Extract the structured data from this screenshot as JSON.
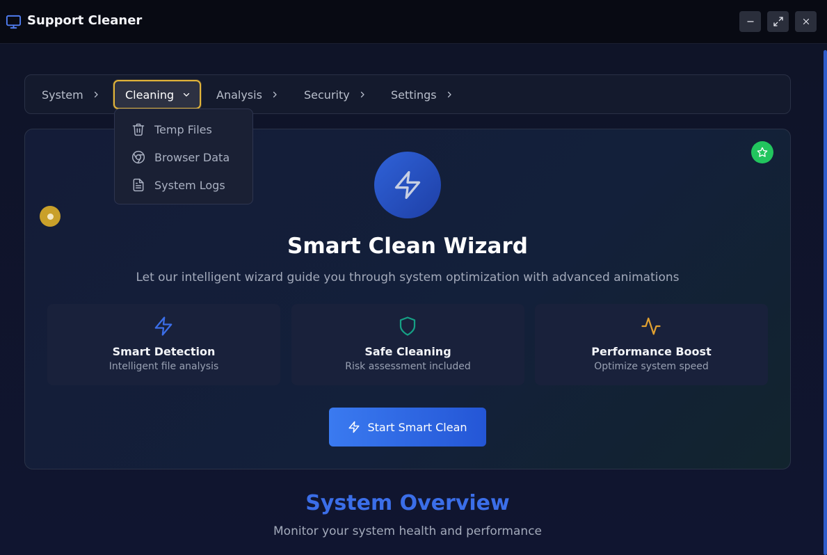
{
  "window": {
    "title": "Support Cleaner",
    "app_icon": "monitor-icon",
    "controls": [
      "minimize-icon",
      "maximize-icon",
      "close-icon"
    ]
  },
  "nav": {
    "items": [
      {
        "label": "System",
        "icon": "chevron-right-icon"
      },
      {
        "label": "Cleaning",
        "icon": "chevron-down-icon",
        "active": true
      },
      {
        "label": "Analysis",
        "icon": "chevron-right-icon"
      },
      {
        "label": "Security",
        "icon": "chevron-right-icon"
      },
      {
        "label": "Settings",
        "icon": "chevron-right-icon"
      }
    ],
    "dropdown": [
      {
        "label": "Temp Files",
        "icon": "trash-icon"
      },
      {
        "label": "Browser Data",
        "icon": "chrome-icon"
      },
      {
        "label": "System Logs",
        "icon": "file-text-icon"
      }
    ]
  },
  "wizard": {
    "title": "Smart Clean Wizard",
    "subtitle": "Let our intelligent wizard guide you through system optimization with advanced animations",
    "hero_icon": "zap-icon",
    "features": [
      {
        "title": "Smart Detection",
        "desc": "Intelligent file analysis",
        "icon": "zap-icon",
        "color": "#3b6ee8"
      },
      {
        "title": "Safe Cleaning",
        "desc": "Risk assessment included",
        "icon": "shield-icon",
        "color": "#16a085"
      },
      {
        "title": "Performance Boost",
        "desc": "Optimize system speed",
        "icon": "activity-icon",
        "color": "#e0a030"
      }
    ],
    "start_button": "Start Smart Clean"
  },
  "overview": {
    "title": "System Overview",
    "subtitle": "Monitor your system health and performance"
  },
  "colors": {
    "accent": "#3b6ee8",
    "active_outline": "#e3b53a",
    "success": "#22c55e"
  }
}
